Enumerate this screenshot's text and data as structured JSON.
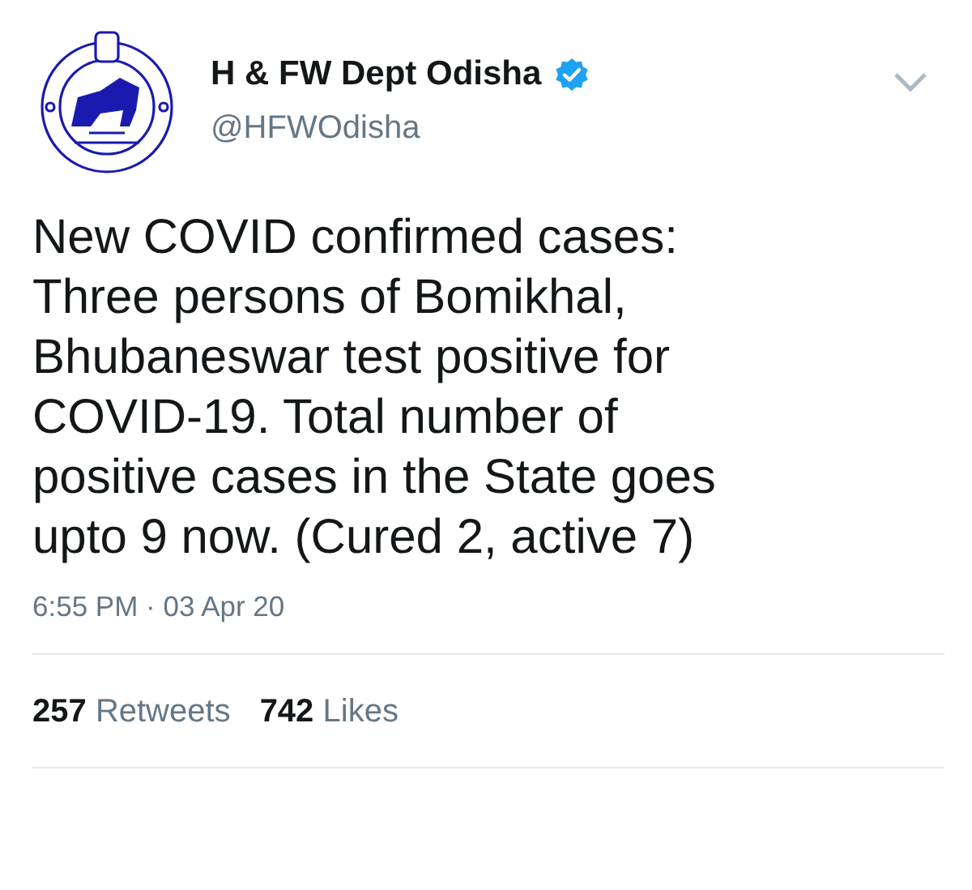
{
  "author": {
    "name": "H & FW Dept Odisha",
    "verified": true,
    "handle": "@HFWOdisha"
  },
  "tweet": {
    "lines": [
      "New COVID confirmed cases:",
      "Three persons of Bomikhal,",
      "Bhubaneswar test positive for",
      "COVID-19. Total number of",
      "positive cases in the State goes",
      "upto 9 now. (Cured 2, active 7)"
    ]
  },
  "timestamp": "6:55 PM · 03 Apr 20",
  "stats": [
    {
      "count": "257",
      "label": "Retweets"
    },
    {
      "count": "742",
      "label": "Likes"
    }
  ]
}
